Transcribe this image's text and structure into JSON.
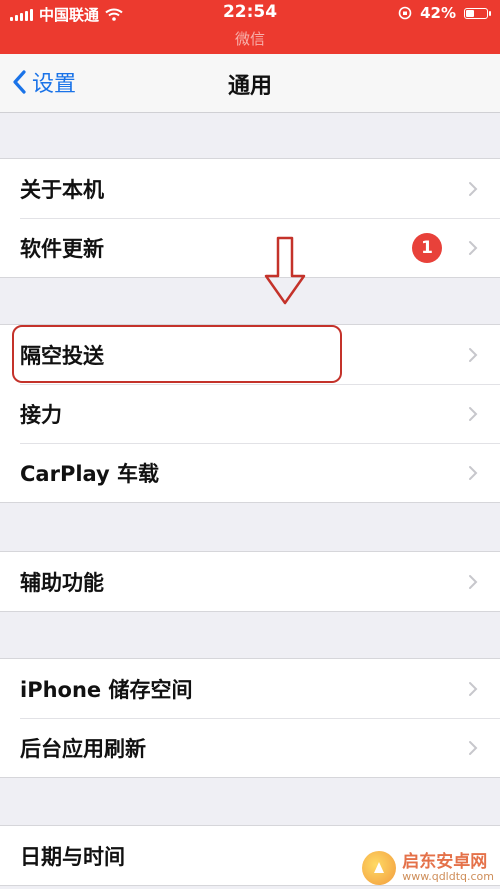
{
  "status_bar": {
    "carrier": "中国联通",
    "time": "22:54",
    "app_name": "微信",
    "battery_percent": "42%",
    "battery_level": 0.42,
    "background_color": "#ec3a2f"
  },
  "nav": {
    "back_label": "设置",
    "title": "通用",
    "accent_color": "#1a73e8"
  },
  "groups": [
    {
      "rows": [
        {
          "label": "关于本机"
        },
        {
          "label": "软件更新",
          "badge": "1"
        }
      ]
    },
    {
      "rows": [
        {
          "label": "隔空投送"
        },
        {
          "label": "接力"
        },
        {
          "label": "CarPlay 车载"
        }
      ]
    },
    {
      "rows": [
        {
          "label": "辅助功能"
        }
      ]
    },
    {
      "rows": [
        {
          "label": "iPhone 储存空间"
        },
        {
          "label": "后台应用刷新"
        }
      ]
    },
    {
      "rows": [
        {
          "label": "日期与时间"
        }
      ]
    }
  ],
  "annotation": {
    "highlight_color": "#c4322a",
    "arrow_icon": "down-arrow-outline-icon"
  },
  "watermark": {
    "name": "启东安卓网",
    "url": "www.qdldtq.com"
  }
}
